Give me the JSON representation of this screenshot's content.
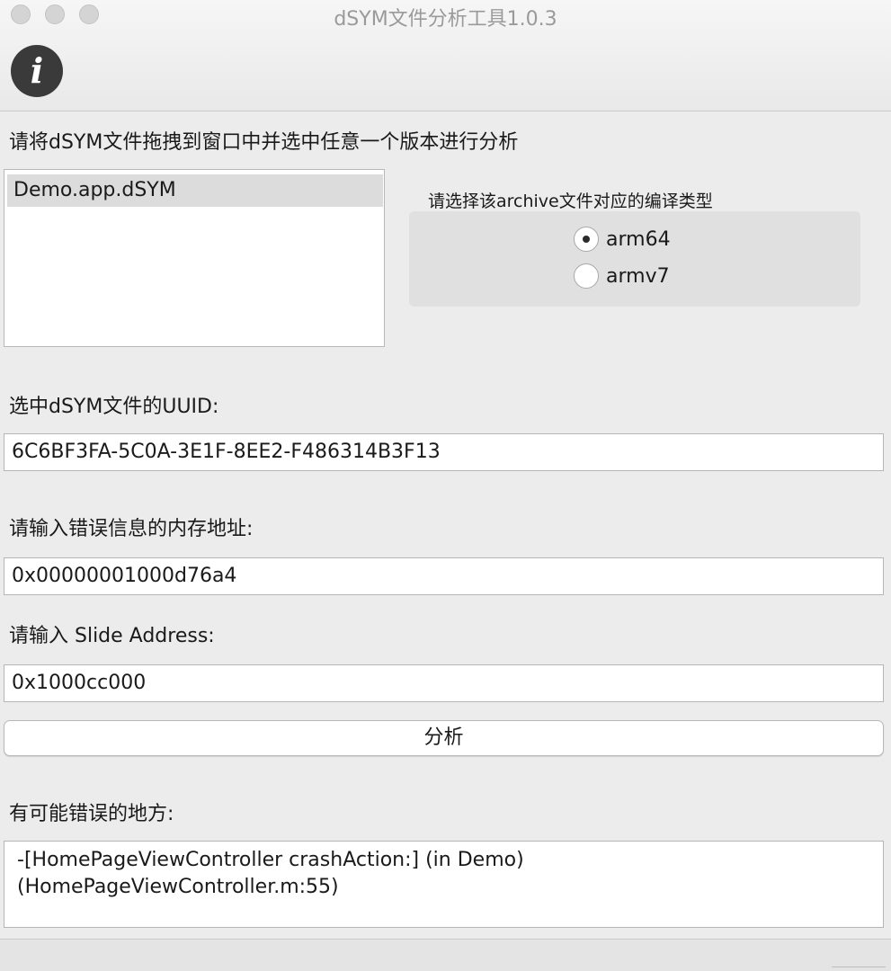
{
  "window": {
    "title": "dSYM文件分析工具1.0.3",
    "info_button_glyph": "i"
  },
  "colors": {
    "background": "#ececec",
    "info_button": "#3a3a3a",
    "title_text": "#9a9a9a"
  },
  "drop_instruction": "请将dSYM文件拖拽到窗口中并选中任意一个版本进行分析",
  "dsym_list": {
    "items": [
      {
        "label": "Demo.app.dSYM",
        "selected": true
      }
    ]
  },
  "build_type": {
    "title": "请选择该archive文件对应的编译类型",
    "options": [
      {
        "label": "arm64",
        "checked": true
      },
      {
        "label": "armv7",
        "checked": false
      }
    ]
  },
  "uuid": {
    "label": "选中dSYM文件的UUID:",
    "value": "6C6BF3FA-5C0A-3E1F-8EE2-F486314B3F13"
  },
  "memory_address": {
    "label": "请输入错误信息的内存地址:",
    "value": "0x00000001000d76a4"
  },
  "slide_address": {
    "label": "请输入 Slide Address:",
    "value": "0x1000cc000"
  },
  "analyze_button": {
    "label": "分析"
  },
  "result": {
    "label": "有可能错误的地方:",
    "lines": [
      "-[HomePageViewController crashAction:] (in Demo)",
      "(HomePageViewController.m:55)"
    ]
  }
}
